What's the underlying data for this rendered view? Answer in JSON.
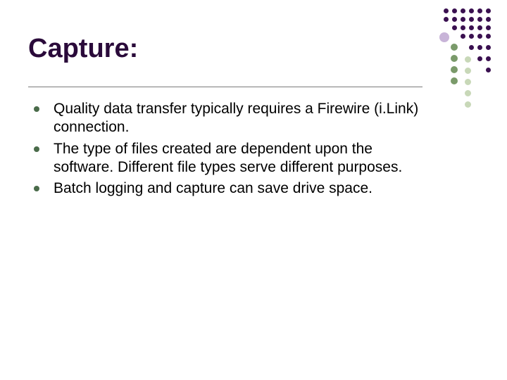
{
  "title": "Capture:",
  "bullets": [
    "Quality data transfer typically requires a Firewire (i.Link) connection.",
    "The type of files created are dependent upon the software.  Different file types serve different purposes.",
    "Batch logging and capture can save drive space."
  ],
  "decoration": {
    "darkPurple": "#3a1050",
    "lightPurple": "#b8a0c8",
    "green": "#7a9a6a",
    "lightGreen": "#c8d8b8"
  }
}
